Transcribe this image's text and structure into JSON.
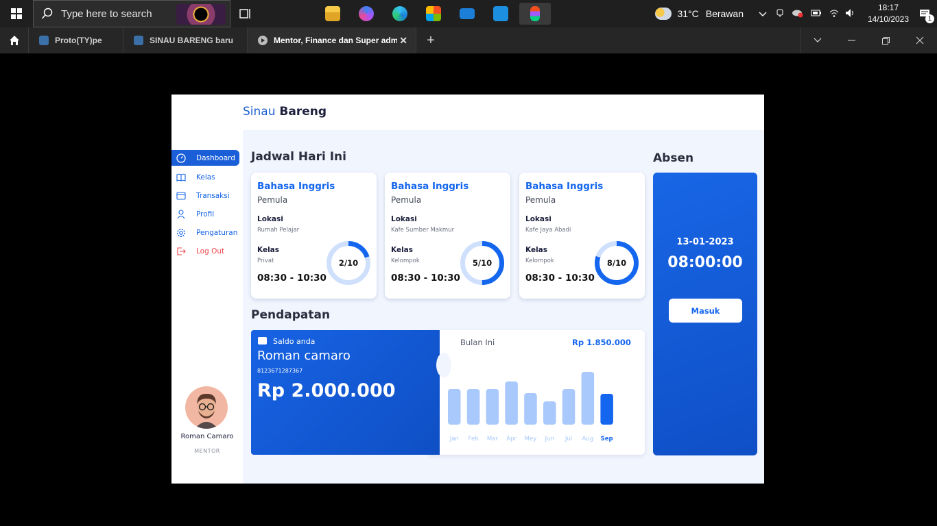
{
  "taskbar": {
    "search_placeholder": "Type here to search",
    "weather": {
      "temp": "31°C",
      "desc": "Berawan"
    },
    "clock": {
      "time": "18:17",
      "date": "14/10/2023"
    },
    "notifications": "1",
    "apps": [
      "file-explorer",
      "copilot",
      "edge",
      "store",
      "mail",
      "trello",
      "figma"
    ]
  },
  "browser": {
    "tabs": [
      {
        "label": "Proto(TY)pe"
      },
      {
        "label": "SINAU BARENG baru"
      },
      {
        "label": "Mentor, Finance dan Super admin ·"
      }
    ],
    "new_tab": "+"
  },
  "app": {
    "brand_part1": "Sinau",
    "brand_part2": "Bareng",
    "nav": [
      {
        "label": "Dashboard",
        "icon": "gauge-icon",
        "active": true
      },
      {
        "label": "Kelas",
        "icon": "book-icon"
      },
      {
        "label": "Transaksi",
        "icon": "wallet-icon"
      },
      {
        "label": "Profil",
        "icon": "user-icon"
      },
      {
        "label": "Pengaturan",
        "icon": "gear-icon"
      },
      {
        "label": "Log Out",
        "icon": "logout-icon"
      }
    ],
    "user": {
      "name": "Roman Camaro",
      "role": "MENTOR"
    },
    "schedule_title": "Jadwal Hari Ini",
    "schedule": [
      {
        "title": "Bahasa Inggris",
        "level": "Pemula",
        "lokasi_label": "Lokasi",
        "lokasi": "Rumah Pelajar",
        "kelas_label": "Kelas",
        "kelas": "Privat",
        "time": "08:30 - 10:30",
        "progress_label": "2/10",
        "progress": 0.2
      },
      {
        "title": "Bahasa Inggris",
        "level": "Pemula",
        "lokasi_label": "Lokasi",
        "lokasi": "Kafe Sumber Makmur",
        "kelas_label": "Kelas",
        "kelas": "Kelompok",
        "time": "08:30 - 10:30",
        "progress_label": "5/10",
        "progress": 0.5
      },
      {
        "title": "Bahasa Inggris",
        "level": "Pemula",
        "lokasi_label": "Lokasi",
        "lokasi": "Kafe Jaya Abadi",
        "kelas_label": "Kelas",
        "kelas": "Kelompok",
        "time": "08:30 - 10:30",
        "progress_label": "8/10",
        "progress": 0.8
      }
    ],
    "income_title": "Pendapatan",
    "saldo": {
      "label": "Saldo anda",
      "name": "Roman camaro",
      "account": "8123671287367",
      "amount": "Rp 2.000.000"
    },
    "monthly": {
      "label": "Bulan Ini",
      "amount": "Rp 1.850.000"
    },
    "absen": {
      "title": "Absen",
      "date": "13-01-2023",
      "time": "08:00:00",
      "button": "Masuk"
    },
    "colors": {
      "primary": "#1466ee",
      "bar_light": "#a9c8fb",
      "bar_active": "#1466ee",
      "logout": "#f0464d"
    }
  },
  "chart_data": {
    "type": "bar",
    "categories": [
      "Jan",
      "Feb",
      "Mar",
      "Apr",
      "Mey",
      "Jun",
      "Jul",
      "Aug",
      "Sep"
    ],
    "values": [
      52,
      52,
      52,
      63,
      46,
      34,
      52,
      77,
      45
    ],
    "highlight": "Sep",
    "title": "",
    "xlabel": "",
    "ylabel": ""
  }
}
